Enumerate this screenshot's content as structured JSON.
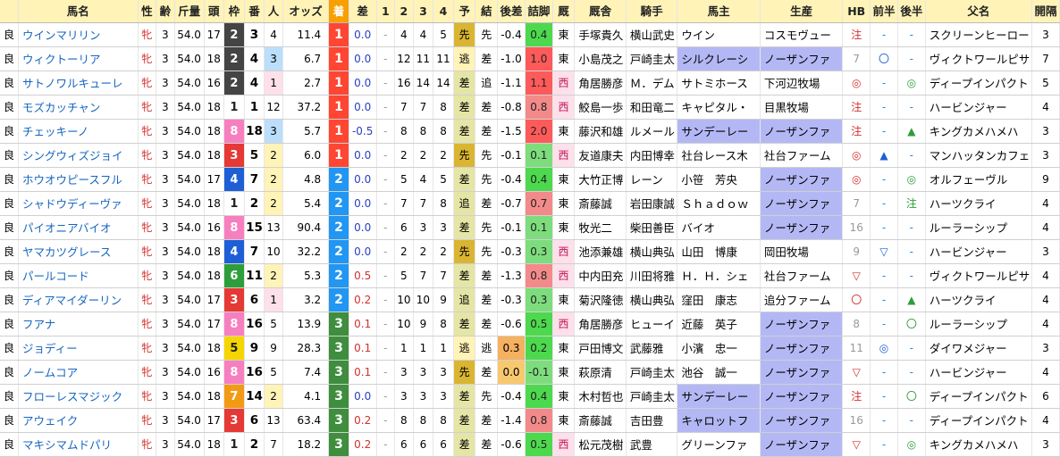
{
  "headers": [
    "馬名",
    "性",
    "齢",
    "斤量",
    "頭",
    "枠",
    "番",
    "人",
    "オッズ",
    "着",
    "差",
    "1",
    "2",
    "3",
    "4",
    "予",
    "結",
    "後差",
    "詰脚",
    "厩",
    "厩舎",
    "騎手",
    "馬主",
    "生産",
    "HB",
    "前半",
    "後半",
    "父名",
    "開隔"
  ],
  "colors": {
    "waku": {
      "1": "#ffffff",
      "2": "#444444",
      "3": "#e53935",
      "4": "#1e5fd6",
      "5": "#f5d600",
      "6": "#2e9e3a",
      "7": "#f39a14",
      "8": "#f77fbf"
    },
    "chaku": {
      "1": "#ff4633",
      "2": "#2196f3",
      "3": "#3e8e3e"
    },
    "sakimark": "#ffd54f",
    "highlight": "#b3b8f5",
    "blue_cell": "#bbdefb",
    "pink_cell": "#fde0ea",
    "yosou": {
      "先": "#d9b531",
      "逃": "#fff3b8",
      "差": "#e5e5a6",
      "追": "#e5e5a6"
    },
    "tsume_scale": {
      "high": "#ff5a5a",
      "mid": "#f38a8a",
      "low": "#7ddd7d",
      "green": "#4dd94d"
    }
  },
  "rows": [
    {
      "baba": "良",
      "name": "ウインマリリン",
      "sex": "牝",
      "age": "3",
      "kin": "54.0",
      "tou": "17",
      "waku": "2",
      "ban": "3",
      "nin": "4",
      "odds": "11.4",
      "chaku": "1",
      "sa": "0.0",
      "c1": "-",
      "c2": "4",
      "c3": "4",
      "c4": "5",
      "yo": "先",
      "ke": "先",
      "ato": "-0.4",
      "tsume": "0.4",
      "tsume_c": "green",
      "ry": "東",
      "kyu": "手塚貴久",
      "jockey": "横山武史",
      "owner": "ウイン",
      "owner_hl": false,
      "prod": "コスモヴュー",
      "prod_hl": false,
      "hb": "注",
      "zen": "-",
      "kou": "-",
      "father": "スクリーンヒーロー",
      "kankaku": "3"
    },
    {
      "baba": "良",
      "name": "ウィクトーリア",
      "sex": "牝",
      "age": "3",
      "kin": "54.0",
      "tou": "18",
      "waku": "2",
      "ban": "4",
      "nin": "3",
      "odds": "6.7",
      "chaku": "1",
      "sa": "0.0",
      "c1": "-",
      "c2": "12",
      "c3": "11",
      "c4": "11",
      "yo": "逃",
      "ke": "差",
      "ato": "-1.0",
      "tsume": "1.0",
      "tsume_c": "high",
      "ry": "東",
      "kyu": "小島茂之",
      "jockey": "戸崎圭太",
      "owner": "シルクレーシ",
      "owner_hl": true,
      "prod": "ノーザンファ",
      "prod_hl": true,
      "hb": "7",
      "zen": "〇",
      "kou": "-",
      "father": "ヴィクトワールピサ",
      "kankaku": "7"
    },
    {
      "baba": "良",
      "name": "サトノワルキューレ",
      "sex": "牝",
      "age": "3",
      "kin": "54.0",
      "tou": "16",
      "waku": "2",
      "ban": "4",
      "nin": "1",
      "odds": "2.7",
      "chaku": "1",
      "sa": "0.0",
      "c1": "-",
      "c2": "16",
      "c3": "14",
      "c4": "14",
      "yo": "差",
      "ke": "追",
      "ato": "-1.1",
      "tsume": "1.1",
      "tsume_c": "high",
      "ry": "西",
      "kyu": "角居勝彦",
      "jockey": "Ｍ．デム",
      "owner": "サトミホース",
      "owner_hl": false,
      "prod": "下河辺牧場",
      "prod_hl": false,
      "hb": "◎",
      "zen": "-",
      "kou": "◎",
      "father": "ディープインパクト",
      "kankaku": "5"
    },
    {
      "baba": "良",
      "name": "モズカッチャン",
      "sex": "牝",
      "age": "3",
      "kin": "54.0",
      "tou": "18",
      "waku": "1",
      "ban": "1",
      "nin": "12",
      "odds": "37.2",
      "chaku": "1",
      "sa": "0.0",
      "c1": "-",
      "c2": "7",
      "c3": "7",
      "c4": "8",
      "yo": "差",
      "ke": "差",
      "ato": "-0.8",
      "tsume": "0.8",
      "tsume_c": "mid",
      "ry": "西",
      "kyu": "鮫島一歩",
      "jockey": "和田竜二",
      "owner": "キャピタル・",
      "owner_hl": false,
      "prod": "目黒牧場",
      "prod_hl": false,
      "hb": "注",
      "zen": "-",
      "kou": "-",
      "father": "ハービンジャー",
      "kankaku": "4"
    },
    {
      "baba": "良",
      "name": "チェッキーノ",
      "sex": "牝",
      "age": "3",
      "kin": "54.0",
      "tou": "18",
      "waku": "8",
      "ban": "18",
      "nin": "3",
      "odds": "5.7",
      "chaku": "1",
      "sa": "-0.5",
      "c1": "-",
      "c2": "8",
      "c3": "8",
      "c4": "8",
      "yo": "差",
      "ke": "差",
      "ato": "-1.5",
      "tsume": "2.0",
      "tsume_c": "high",
      "ry": "東",
      "kyu": "藤沢和雄",
      "jockey": "ルメール",
      "owner": "サンデーレー",
      "owner_hl": true,
      "prod": "ノーザンファ",
      "prod_hl": true,
      "hb": "注",
      "zen": "-",
      "kou": "▲",
      "father": "キングカメハメハ",
      "kankaku": "3"
    },
    {
      "baba": "良",
      "name": "シングウィズジョイ",
      "sex": "牝",
      "age": "3",
      "kin": "54.0",
      "tou": "18",
      "waku": "3",
      "ban": "5",
      "nin": "2",
      "odds": "6.0",
      "chaku": "1",
      "sa": "0.0",
      "c1": "-",
      "c2": "2",
      "c3": "2",
      "c4": "2",
      "yo": "先",
      "ke": "先",
      "ato": "-0.1",
      "tsume": "0.1",
      "tsume_c": "low",
      "ry": "西",
      "kyu": "友道康夫",
      "jockey": "内田博幸",
      "owner": "社台レース木",
      "owner_hl": false,
      "prod": "社台ファーム",
      "prod_hl": false,
      "hb": "◎",
      "zen": "▲",
      "kou": "-",
      "father": "マンハッタンカフェ",
      "kankaku": "3"
    },
    {
      "baba": "良",
      "name": "ホウオウピースフル",
      "sex": "牝",
      "age": "3",
      "kin": "54.0",
      "tou": "17",
      "waku": "4",
      "ban": "7",
      "nin": "2",
      "odds": "4.8",
      "chaku": "2",
      "sa": "0.0",
      "c1": "-",
      "c2": "5",
      "c3": "4",
      "c4": "5",
      "yo": "差",
      "ke": "先",
      "ato": "-0.4",
      "tsume": "0.4",
      "tsume_c": "green",
      "ry": "東",
      "kyu": "大竹正博",
      "jockey": "レーン",
      "owner": "小笹　芳央",
      "owner_hl": false,
      "prod": "ノーザンファ",
      "prod_hl": true,
      "hb": "◎",
      "zen": "-",
      "kou": "◎",
      "father": "オルフェーヴル",
      "kankaku": "9"
    },
    {
      "baba": "良",
      "name": "シャドウディーヴァ",
      "sex": "牝",
      "age": "3",
      "kin": "54.0",
      "tou": "18",
      "waku": "1",
      "ban": "2",
      "nin": "2",
      "odds": "5.4",
      "chaku": "2",
      "sa": "0.0",
      "c1": "-",
      "c2": "7",
      "c3": "7",
      "c4": "8",
      "yo": "追",
      "ke": "差",
      "ato": "-0.7",
      "tsume": "0.7",
      "tsume_c": "mid",
      "ry": "東",
      "kyu": "斎藤誠",
      "jockey": "岩田康誠",
      "owner": "Ｓｈａｄｏｗ",
      "owner_hl": false,
      "prod": "ノーザンファ",
      "prod_hl": true,
      "hb": "7",
      "zen": "-",
      "kou": "注",
      "father": "ハーツクライ",
      "kankaku": "4"
    },
    {
      "baba": "良",
      "name": "パイオニアバイオ",
      "sex": "牝",
      "age": "3",
      "kin": "54.0",
      "tou": "16",
      "waku": "8",
      "ban": "15",
      "nin": "13",
      "odds": "90.4",
      "chaku": "2",
      "sa": "0.0",
      "c1": "-",
      "c2": "6",
      "c3": "3",
      "c4": "3",
      "yo": "差",
      "ke": "先",
      "ato": "-0.1",
      "tsume": "0.1",
      "tsume_c": "low",
      "ry": "東",
      "kyu": "牧光二",
      "jockey": "柴田善臣",
      "owner": "バイオ",
      "owner_hl": false,
      "prod": "ノーザンファ",
      "prod_hl": true,
      "hb": "16",
      "zen": "-",
      "kou": "-",
      "father": "ルーラーシップ",
      "kankaku": "4"
    },
    {
      "baba": "良",
      "name": "ヤマカツグレース",
      "sex": "牝",
      "age": "3",
      "kin": "54.0",
      "tou": "18",
      "waku": "4",
      "ban": "7",
      "nin": "10",
      "odds": "32.2",
      "chaku": "2",
      "sa": "0.0",
      "c1": "-",
      "c2": "2",
      "c3": "2",
      "c4": "2",
      "yo": "先",
      "ke": "先",
      "ato": "-0.3",
      "tsume": "0.3",
      "tsume_c": "low",
      "ry": "西",
      "kyu": "池添兼雄",
      "jockey": "横山典弘",
      "owner": "山田　博康",
      "owner_hl": false,
      "prod": "岡田牧場",
      "prod_hl": false,
      "hb": "9",
      "zen": "▽",
      "kou": "-",
      "father": "ハービンジャー",
      "kankaku": "3"
    },
    {
      "baba": "良",
      "name": "パールコード",
      "sex": "牝",
      "age": "3",
      "kin": "54.0",
      "tou": "18",
      "waku": "6",
      "ban": "11",
      "nin": "2",
      "odds": "5.3",
      "chaku": "2",
      "sa": "0.5",
      "c1": "-",
      "c2": "5",
      "c3": "7",
      "c4": "7",
      "yo": "差",
      "ke": "差",
      "ato": "-1.3",
      "tsume": "0.8",
      "tsume_c": "mid",
      "ry": "西",
      "kyu": "中内田充",
      "jockey": "川田将雅",
      "owner": "Ｈ．Ｈ．シェ",
      "owner_hl": false,
      "prod": "社台ファーム",
      "prod_hl": false,
      "hb": "▽",
      "zen": "-",
      "kou": "-",
      "father": "ヴィクトワールピサ",
      "kankaku": "4"
    },
    {
      "baba": "良",
      "name": "ディアマイダーリン",
      "sex": "牝",
      "age": "3",
      "kin": "54.0",
      "tou": "17",
      "waku": "3",
      "ban": "6",
      "nin": "1",
      "odds": "3.2",
      "chaku": "2",
      "sa": "0.2",
      "c1": "-",
      "c2": "10",
      "c3": "10",
      "c4": "9",
      "yo": "追",
      "ke": "差",
      "ato": "-0.3",
      "tsume": "0.3",
      "tsume_c": "low",
      "ry": "東",
      "kyu": "菊沢隆徳",
      "jockey": "横山典弘",
      "owner": "窪田　康志",
      "owner_hl": false,
      "prod": "追分ファーム",
      "prod_hl": false,
      "hb": "〇",
      "zen": "-",
      "kou": "▲",
      "father": "ハーツクライ",
      "kankaku": "4"
    },
    {
      "baba": "良",
      "name": "フアナ",
      "sex": "牝",
      "age": "3",
      "kin": "54.0",
      "tou": "17",
      "waku": "8",
      "ban": "16",
      "nin": "5",
      "odds": "13.9",
      "chaku": "3",
      "sa": "0.1",
      "c1": "-",
      "c2": "10",
      "c3": "9",
      "c4": "8",
      "yo": "差",
      "ke": "差",
      "ato": "-0.6",
      "tsume": "0.5",
      "tsume_c": "green",
      "ry": "西",
      "kyu": "角居勝彦",
      "jockey": "ヒューイ",
      "owner": "近藤　英子",
      "owner_hl": false,
      "prod": "ノーザンファ",
      "prod_hl": true,
      "hb": "8",
      "zen": "-",
      "kou": "〇",
      "father": "ルーラーシップ",
      "kankaku": "4"
    },
    {
      "baba": "良",
      "name": "ジョディー",
      "sex": "牝",
      "age": "3",
      "kin": "54.0",
      "tou": "18",
      "waku": "5",
      "ban": "9",
      "nin": "9",
      "odds": "28.3",
      "chaku": "3",
      "sa": "0.1",
      "c1": "-",
      "c2": "1",
      "c3": "1",
      "c4": "1",
      "yo": "逃",
      "ke": "逃",
      "ato": "0.3",
      "tsume": "0.2",
      "tsume_c": "green",
      "ry": "東",
      "kyu": "戸田博文",
      "jockey": "武藤雅",
      "owner": "小濱　忠一",
      "owner_hl": false,
      "prod": "ノーザンファ",
      "prod_hl": true,
      "hb": "11",
      "zen": "◎",
      "kou": "-",
      "father": "ダイワメジャー",
      "kankaku": "3"
    },
    {
      "baba": "良",
      "name": "ノームコア",
      "sex": "牝",
      "age": "3",
      "kin": "54.0",
      "tou": "16",
      "waku": "8",
      "ban": "16",
      "nin": "5",
      "odds": "7.4",
      "chaku": "3",
      "sa": "0.1",
      "c1": "-",
      "c2": "3",
      "c3": "3",
      "c4": "3",
      "yo": "先",
      "ke": "差",
      "ato": "0.0",
      "tsume": "-0.1",
      "tsume_c": "low",
      "ry": "東",
      "kyu": "萩原清",
      "jockey": "戸崎圭太",
      "owner": "池谷　誠一",
      "owner_hl": false,
      "prod": "ノーザンファ",
      "prod_hl": true,
      "hb": "▽",
      "zen": "-",
      "kou": "-",
      "father": "ハービンジャー",
      "kankaku": "4"
    },
    {
      "baba": "良",
      "name": "フローレスマジック",
      "sex": "牝",
      "age": "3",
      "kin": "54.0",
      "tou": "18",
      "waku": "7",
      "ban": "14",
      "nin": "2",
      "odds": "4.1",
      "chaku": "3",
      "sa": "0.0",
      "c1": "-",
      "c2": "3",
      "c3": "3",
      "c4": "3",
      "yo": "差",
      "ke": "先",
      "ato": "-0.4",
      "tsume": "0.4",
      "tsume_c": "green",
      "ry": "東",
      "kyu": "木村哲也",
      "jockey": "戸崎圭太",
      "owner": "サンデーレー",
      "owner_hl": true,
      "prod": "ノーザンファ",
      "prod_hl": true,
      "hb": "注",
      "zen": "-",
      "kou": "〇",
      "father": "ディープインパクト",
      "kankaku": "6"
    },
    {
      "baba": "良",
      "name": "アウェイク",
      "sex": "牝",
      "age": "3",
      "kin": "54.0",
      "tou": "17",
      "waku": "3",
      "ban": "6",
      "nin": "13",
      "odds": "63.4",
      "chaku": "3",
      "sa": "0.2",
      "c1": "-",
      "c2": "8",
      "c3": "8",
      "c4": "8",
      "yo": "差",
      "ke": "差",
      "ato": "-1.4",
      "tsume": "0.8",
      "tsume_c": "mid",
      "ry": "東",
      "kyu": "斎藤誠",
      "jockey": "吉田豊",
      "owner": "キャロットフ",
      "owner_hl": true,
      "prod": "ノーザンファ",
      "prod_hl": true,
      "hb": "16",
      "zen": "-",
      "kou": "-",
      "father": "ディープインパクト",
      "kankaku": "4"
    },
    {
      "baba": "良",
      "name": "マキシマムドパリ",
      "sex": "牝",
      "age": "3",
      "kin": "54.0",
      "tou": "18",
      "waku": "1",
      "ban": "2",
      "nin": "7",
      "odds": "18.2",
      "chaku": "3",
      "sa": "0.2",
      "c1": "-",
      "c2": "6",
      "c3": "6",
      "c4": "6",
      "yo": "差",
      "ke": "差",
      "ato": "-0.6",
      "tsume": "0.5",
      "tsume_c": "green",
      "ry": "西",
      "kyu": "松元茂樹",
      "jockey": "武豊",
      "owner": "グリーンファ",
      "owner_hl": false,
      "prod": "ノーザンファ",
      "prod_hl": true,
      "hb": "▽",
      "zen": "-",
      "kou": "◎",
      "father": "キングカメハメハ",
      "kankaku": "3"
    }
  ]
}
